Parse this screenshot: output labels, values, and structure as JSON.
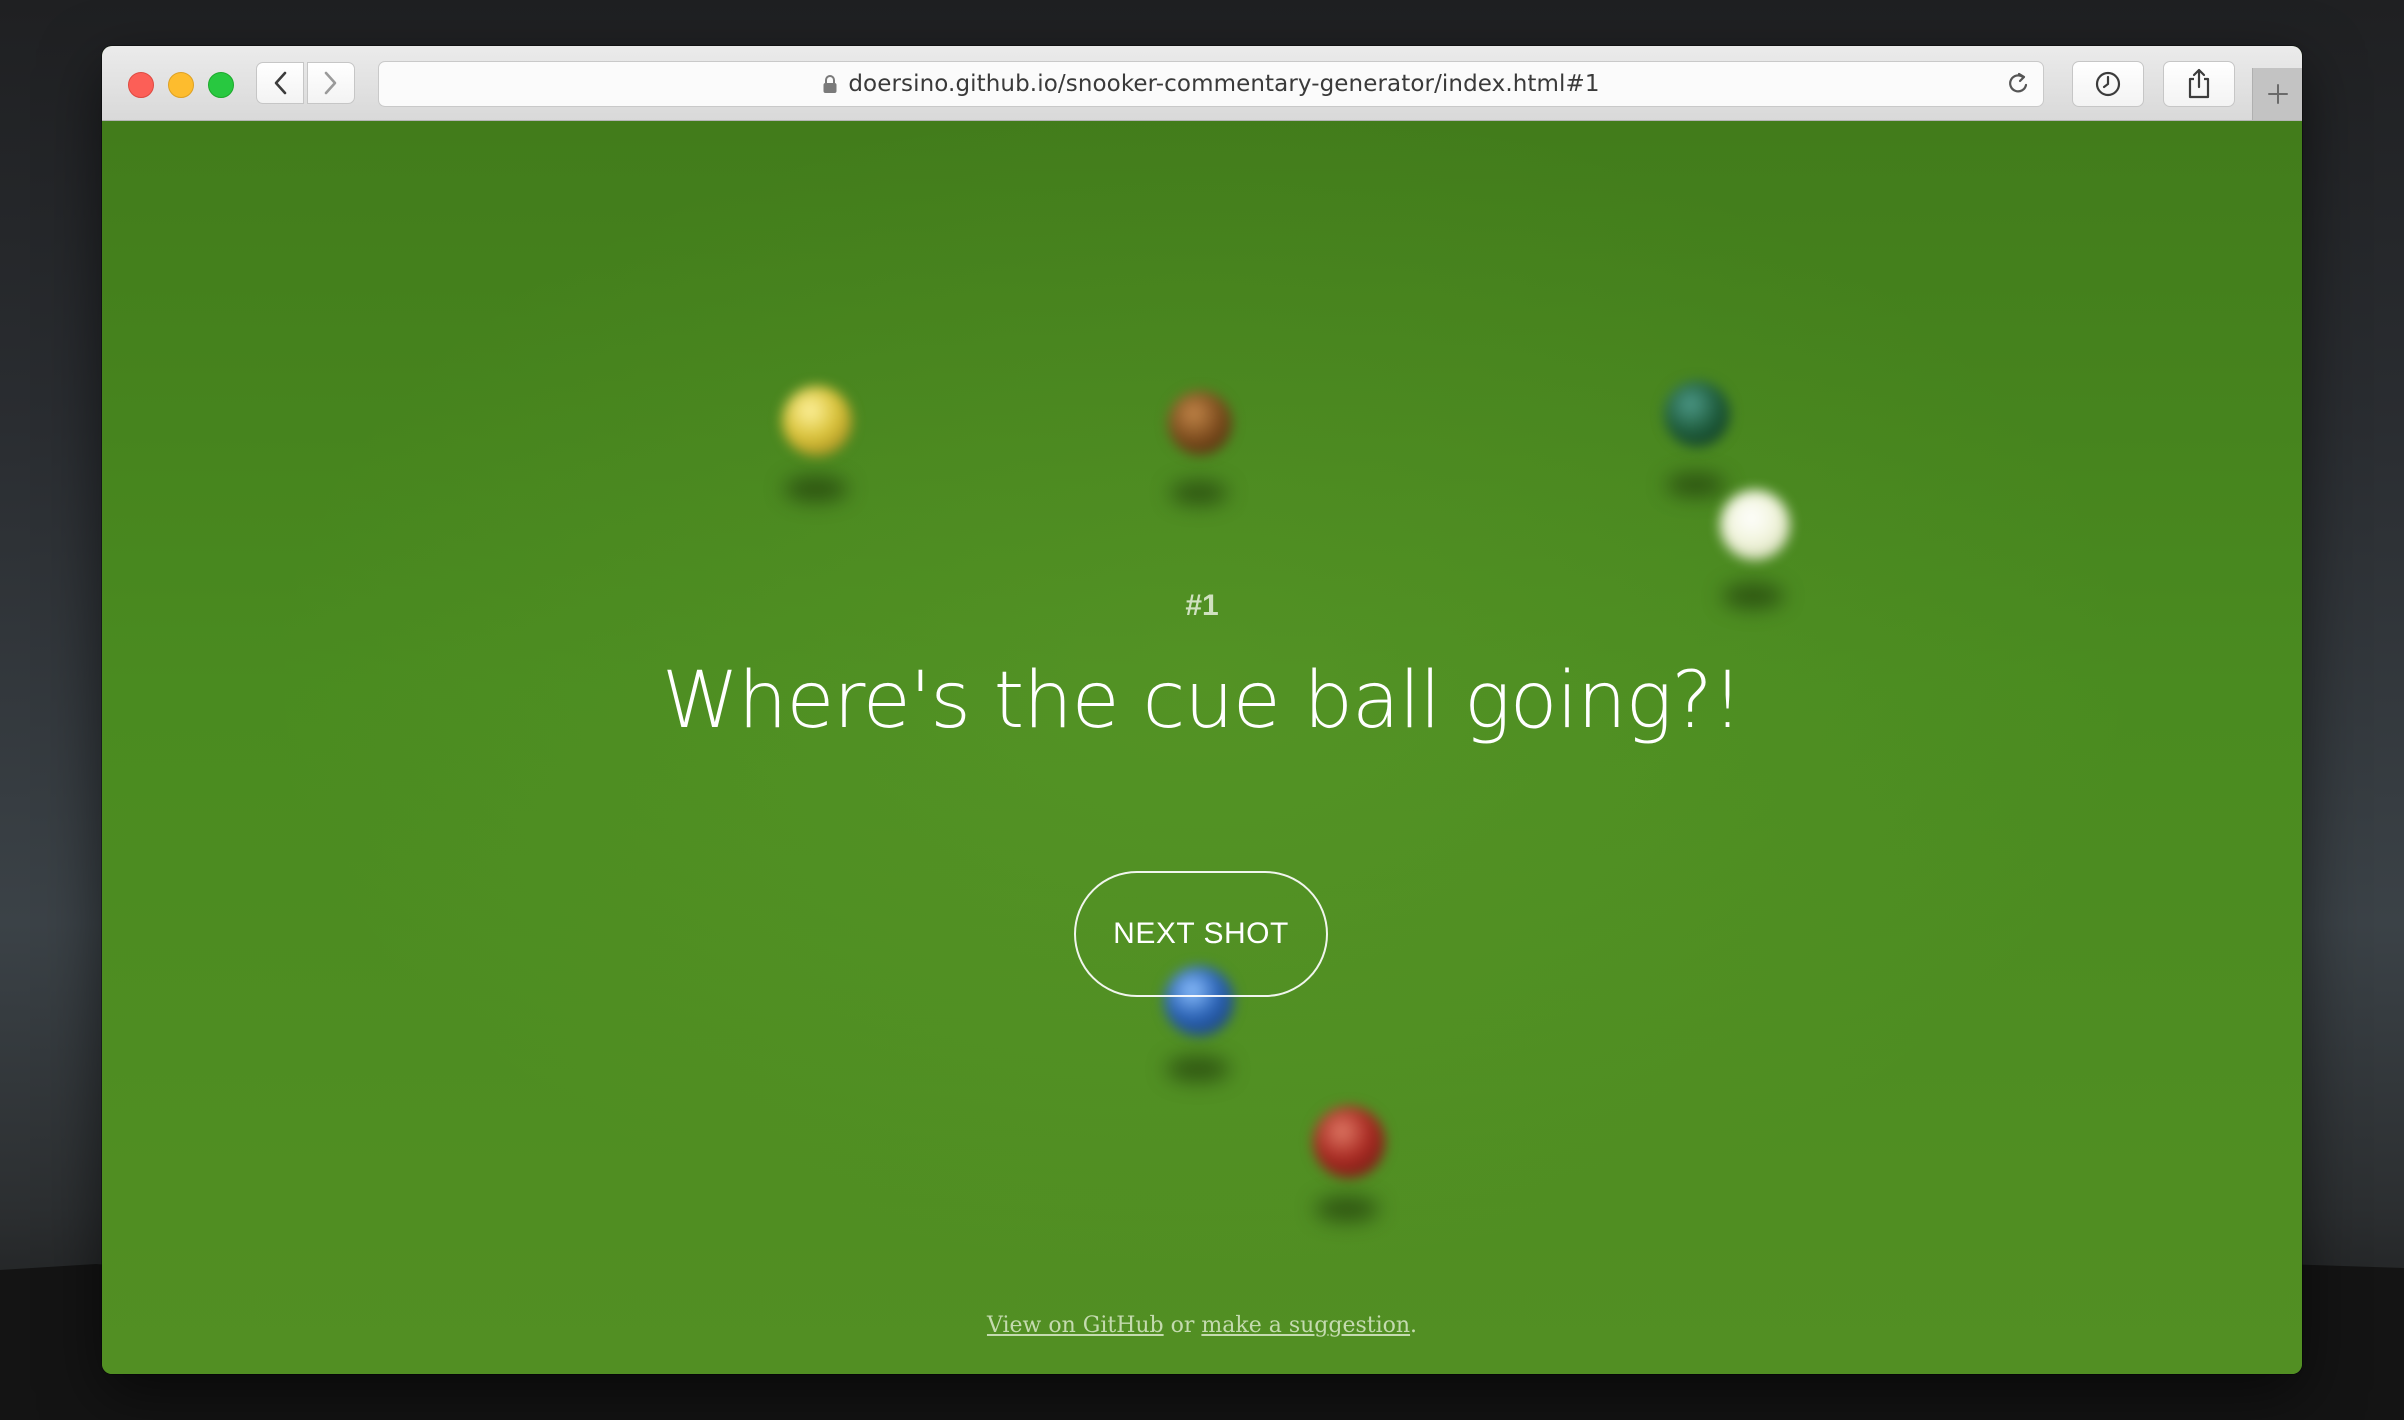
{
  "browser": {
    "url": "doersino.github.io/snooker-commentary-generator/index.html#1"
  },
  "colors": {
    "felt": "#4a8a21",
    "ball_yellow": "#d9c23a",
    "ball_brown": "#7a4a1c",
    "ball_green": "#1d5a3a",
    "ball_cue": "#f1f4dc",
    "ball_blue": "#2a62b5",
    "ball_red": "#a82a22"
  },
  "main": {
    "shot_number": "#1",
    "commentary": "Where's the cue ball going?!",
    "next_button_label": "NEXT SHOT"
  },
  "footer": {
    "github_link": "View on GitHub",
    "separator": " or ",
    "suggestion_link": "make a suggestion",
    "end": "."
  }
}
